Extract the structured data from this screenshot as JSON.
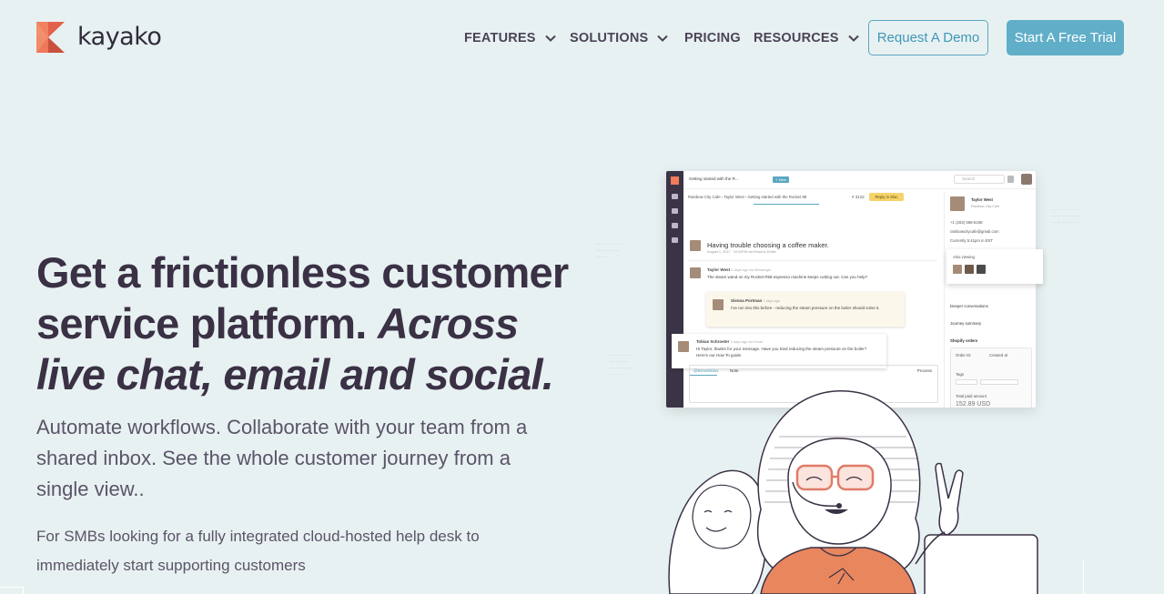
{
  "brand": {
    "name": "kayako"
  },
  "nav": {
    "items": [
      {
        "label": "FEATURES",
        "has_dropdown": true
      },
      {
        "label": "SOLUTIONS",
        "has_dropdown": true
      },
      {
        "label": "PRICING",
        "has_dropdown": false
      },
      {
        "label": "RESOURCES",
        "has_dropdown": true
      }
    ],
    "demo_label": "Request A Demo",
    "trial_label": "Start A Free Trial"
  },
  "hero": {
    "title_plain": "Get a frictionless customer service platform.",
    "title_italic": "Across live chat, email and social.",
    "subtitle": "Automate workflows. Collaborate with your team from a shared inbox. See the whole customer journey from a single view..",
    "note": "For SMBs looking for a fully integrated cloud-hosted help desk to immediately start supporting customers"
  },
  "app_preview": {
    "tab_title": "Getting started with the R...",
    "new_label": "+ New",
    "search_placeholder": "Search",
    "breadcrumb": "Rainbow City Cafe  ›  Taylor West  ›  Getting started with the Rocket 98",
    "ticket_count": "# 3122",
    "reply_label": "Reply in Slac",
    "subject": "Having trouble choosing a coffee maker.",
    "subject_meta": "August 1, 2017 · 10:52PM via Email to Eddie",
    "messages": [
      {
        "author": "Taylor West",
        "meta": "2 days ago via Messenger",
        "text": "The steam wand on my Rocket R58 espresso machine keeps cutting out. Can you help?"
      },
      {
        "author": "Sienna Portman",
        "meta": "2 days ago",
        "text": "I've run into this before - reducing the steam pressure on the boiler should solve it."
      },
      {
        "author": "Tobias Schroeter",
        "meta": "2 days ago via Email",
        "text": "Hi Taylor, thanks for your message. Have you tried reducing the steam pressure on the boiler? Here's our How To guide."
      }
    ],
    "composer_handle": "@BrewWidus",
    "composer_note": "Note",
    "composer_process": "Process",
    "contact": {
      "name": "Taylor West",
      "org": "Rainbow City Cafe",
      "phone": "+1 (203) 558-6158",
      "email": "rainbowcitycafe@gmail.com",
      "local_time": "Currently 5:41pm in EST"
    },
    "also_viewing": "Also viewing",
    "deeper_conversations": "Deeper conversations",
    "journey_summary": "Journey summary",
    "shopify_orders": "Shopify orders",
    "order_id_label": "Order ID",
    "created_at_label": "Created at",
    "tags_label": "Tags",
    "total_label": "Total paid amount",
    "total_value": "152.89 USD"
  },
  "colors": {
    "background": "#e8f1f2",
    "heading": "#3a3145",
    "accent": "#60aec8",
    "brand_orange": "#f27b5a",
    "brand_dark": "#3b3446"
  }
}
